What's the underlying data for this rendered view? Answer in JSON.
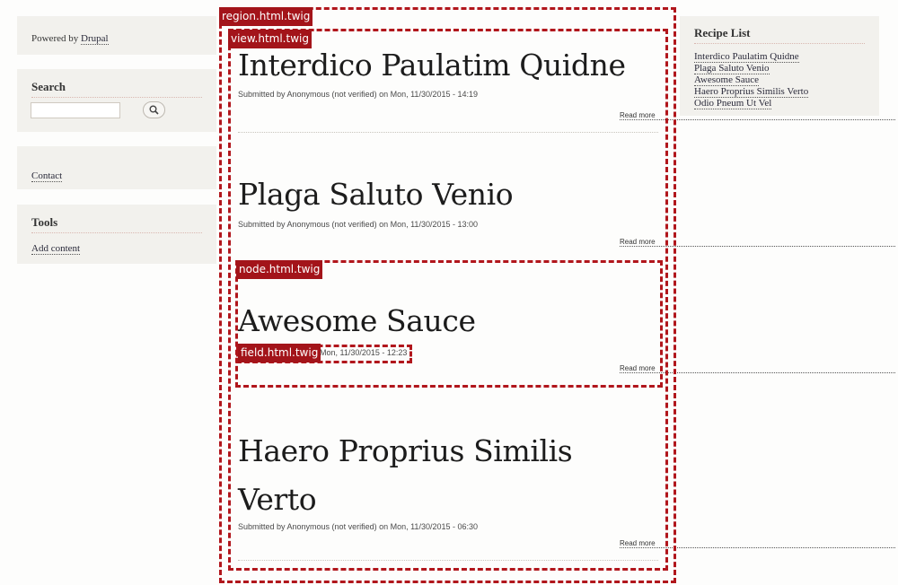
{
  "sidebar_left": {
    "powered": {
      "prefix": "Powered by",
      "link": "Drupal"
    },
    "search": {
      "title": "Search",
      "input_value": "",
      "button_icon": "magnifier-icon"
    },
    "contact": {
      "link": "Contact"
    },
    "tools": {
      "title": "Tools",
      "link": "Add content"
    }
  },
  "sidebar_right": {
    "title": "Recipe List",
    "items": [
      "Interdico Paulatim Quidne",
      "Plaga Saluto Venio",
      "Awesome Sauce",
      "Haero Proprius Similis Verto",
      "Odio Pneum Ut Vel"
    ]
  },
  "overlay_labels": {
    "region": "region.html.twig",
    "view": "view.html.twig",
    "node": "node.html.twig",
    "field": "field.html.twig"
  },
  "articles": [
    {
      "title": "Interdico Paulatim Quidne",
      "meta": "Submitted by Anonymous (not verified) on Mon, 11/30/2015 - 14:19",
      "read_more": "Read more"
    },
    {
      "title": "Plaga Saluto Venio",
      "meta": "Submitted by Anonymous (not verified) on Mon, 11/30/2015 - 13:00",
      "read_more": "Read more"
    },
    {
      "title": "Awesome Sauce",
      "meta": "Mon, 11/30/2015 - 12:23",
      "read_more": "Read more"
    },
    {
      "title_line1": "Haero Proprius Similis",
      "title_line2": "Verto",
      "meta": "Submitted by Anonymous (not verified) on Mon, 11/30/2015 - 06:30",
      "read_more": "Read more"
    }
  ],
  "colors": {
    "overlay_red": "#b1161c",
    "label_bg": "#a3141a",
    "sidebar_bg": "#f2f1ed"
  }
}
